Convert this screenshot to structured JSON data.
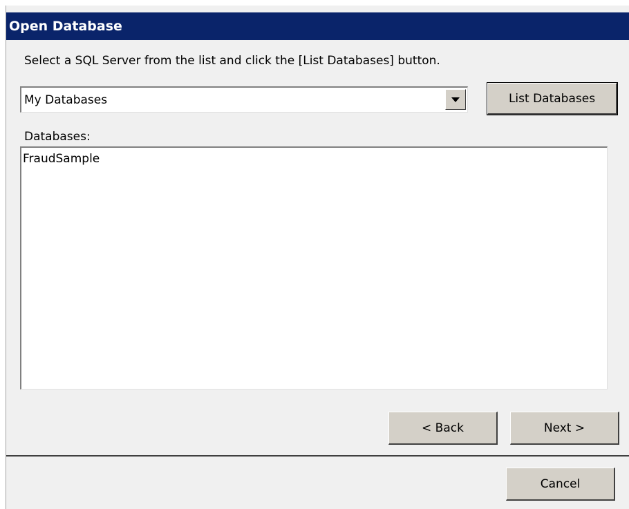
{
  "dialog": {
    "title": "Open Database",
    "instruction": "Select a SQL Server from the list and click the [List Databases] button.",
    "server_combo": {
      "selected": "My Databases",
      "arrow_icon": "chevron-down-icon"
    },
    "list_databases_label": "List Databases",
    "databases_label": "Databases:",
    "databases": [
      "FraudSample"
    ],
    "back_label": "< Back",
    "next_label": "Next >",
    "cancel_label": "Cancel"
  },
  "colors": {
    "titlebar": "#0a246a",
    "dialog_bg": "#f0f0f0",
    "button_face": "#d4d0c8"
  }
}
